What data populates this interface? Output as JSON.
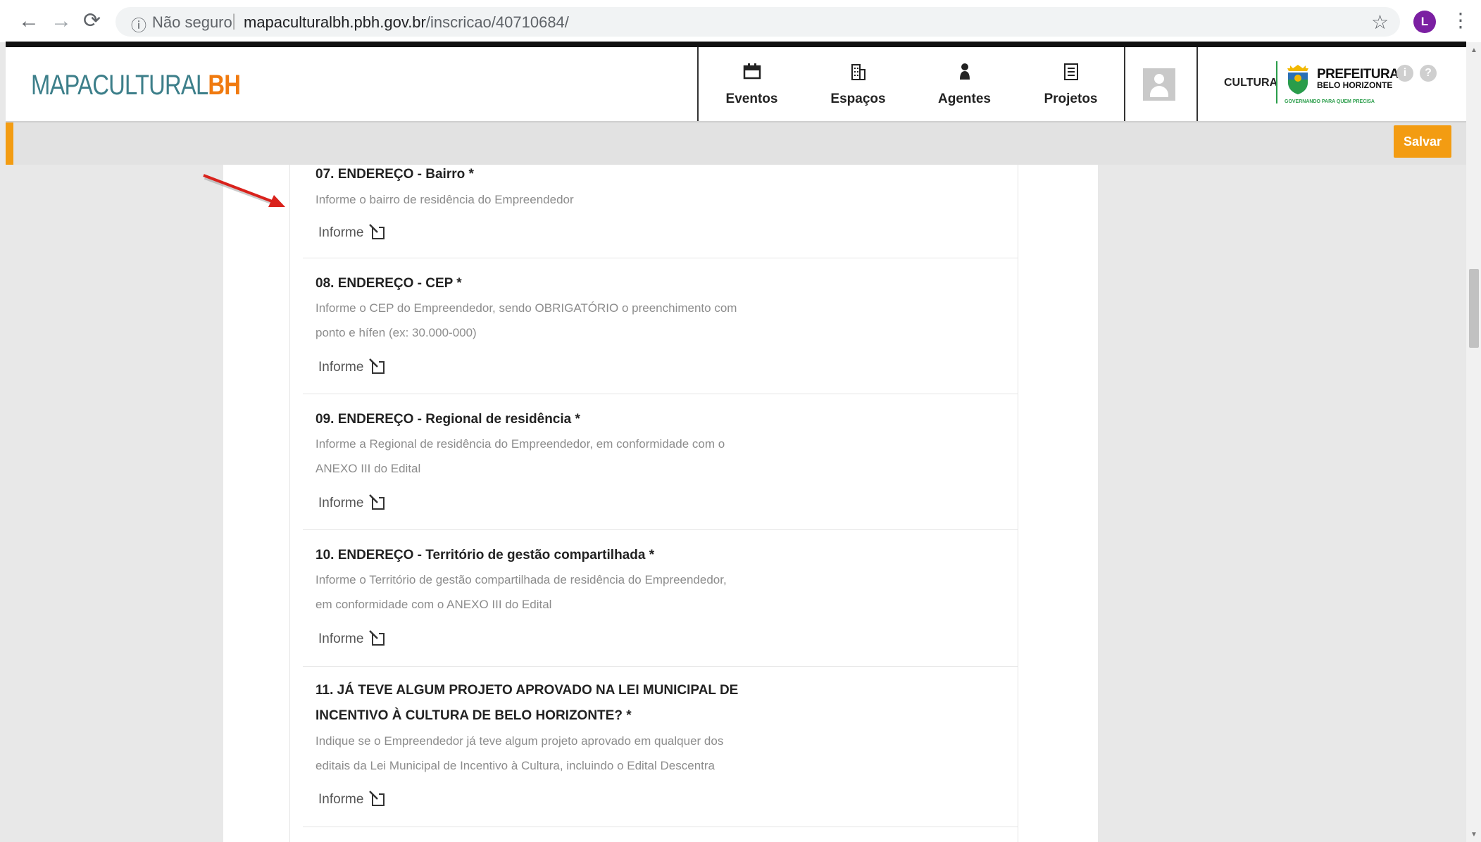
{
  "browser": {
    "security_label": "Não seguro",
    "url_host": "mapaculturalbh.pbh.gov.br",
    "url_path": "/inscricao/40710684/",
    "profile_initial": "L"
  },
  "header": {
    "logo_text": "MAPACULTURAL",
    "logo_accent": "BH",
    "nav": [
      {
        "label": "Eventos",
        "icon": "calendar-icon"
      },
      {
        "label": "Espaços",
        "icon": "building-icon"
      },
      {
        "label": "Agentes",
        "icon": "person-icon"
      },
      {
        "label": "Projetos",
        "icon": "document-icon"
      }
    ],
    "cultura_label": "CULTURA",
    "prefeitura_line1": "PREFEITURA",
    "prefeitura_line2": "BELO HORIZONTE",
    "prefeitura_slogan": "GOVERNANDO PARA QUEM PRECISA"
  },
  "toolbar": {
    "save_label": "Salvar"
  },
  "fields": [
    {
      "title": "07. ENDEREÇO - Bairro *",
      "desc": [
        "Informe o bairro de residência do Empreendedor"
      ],
      "action": "Informe"
    },
    {
      "title": "08. ENDEREÇO - CEP *",
      "desc": [
        "Informe o CEP do Empreendedor, sendo OBRIGATÓRIO o preenchimento com",
        "ponto e hífen (ex: 30.000-000)"
      ],
      "action": "Informe"
    },
    {
      "title": "09. ENDEREÇO - Regional de residência *",
      "desc": [
        "Informe a Regional de residência do Empreendedor, em conformidade com o",
        "ANEXO III do Edital"
      ],
      "action": "Informe"
    },
    {
      "title": "10. ENDEREÇO - Território de gestão compartilhada *",
      "desc": [
        "Informe o Território de gestão compartilhada de residência do Empreendedor,",
        "em conformidade com o ANEXO III do Edital"
      ],
      "action": "Informe"
    },
    {
      "title_lines": [
        "11. JÁ TEVE ALGUM PROJETO APROVADO NA LEI MUNICIPAL DE",
        "INCENTIVO À CULTURA DE BELO HORIZONTE? *"
      ],
      "desc": [
        "Indique se o Empreendedor já teve algum projeto aprovado em qualquer dos",
        "editais da Lei Municipal de Incentivo à Cultura, incluindo o Edital Descentra"
      ],
      "action": "Informe"
    }
  ],
  "colors": {
    "accent": "#f39c12",
    "logo_teal": "#3d7f8a",
    "logo_orange": "#f07a0f",
    "arrow": "#d9221c"
  }
}
